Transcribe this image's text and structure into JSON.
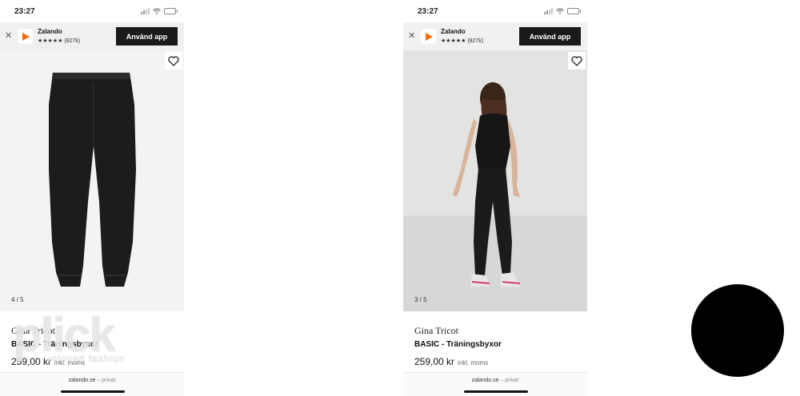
{
  "colors": {
    "accent": "#ff6900",
    "button_bg": "#1a1a1a",
    "banner_bg": "#f0f0f0"
  },
  "screens": [
    {
      "status": {
        "time": "23:27"
      },
      "banner": {
        "close_icon": "close-icon",
        "app_name": "Zalando",
        "rating": "★★★★★ (827k)",
        "install_label": "Använd app"
      },
      "gallery": {
        "image_counter": "4 / 5",
        "image_subject": "flat-trousers",
        "favorite_icon": "heart-icon"
      },
      "product": {
        "brand": "Gina Tricot",
        "title": "BASIC - Träningsbyxor",
        "price": "259,00 kr",
        "tax_note": "inkl. moms"
      },
      "browser": {
        "domain": "zalando.se",
        "mode": "– privat"
      }
    },
    {
      "status": {
        "time": "23:27"
      },
      "banner": {
        "close_icon": "close-icon",
        "app_name": "Zalando",
        "rating": "★★★★★ (827k)",
        "install_label": "Använd app"
      },
      "gallery": {
        "image_counter": "3 / 5",
        "image_subject": "model-back-view",
        "favorite_icon": "heart-icon"
      },
      "product": {
        "brand": "Gina Tricot",
        "title": "BASIC - Träningsbyxor",
        "price": "259,00 kr",
        "tax_note": "inkl. moms"
      },
      "browser": {
        "domain": "zalando.se",
        "mode": "– privat"
      }
    }
  ],
  "watermark": {
    "logo_text": "plick",
    "tagline": "reloved fashion"
  }
}
